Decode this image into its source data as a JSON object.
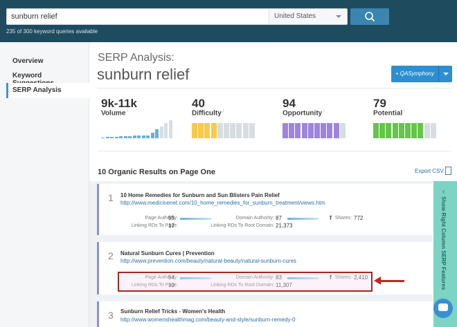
{
  "header": {
    "search_value": "sunburn relief",
    "country": "United States",
    "quota_text": "235 of 300 keyword queries available"
  },
  "sidebar": {
    "items": [
      {
        "label": "Overview"
      },
      {
        "label": "Keyword Suggestions"
      },
      {
        "label": "SERP Analysis",
        "active": true
      }
    ]
  },
  "main": {
    "section_label": "SERP Analysis:",
    "keyword": "sunburn relief",
    "qa_button": "+ QASymphony",
    "metrics": [
      {
        "value": "9k-11k",
        "label": "Volume",
        "color": "#6aaed6",
        "level": 1.0
      },
      {
        "value": "40",
        "label": "Difficulty",
        "color": "#f8c94a",
        "level": 0.4
      },
      {
        "value": "94",
        "label": "Opportunity",
        "color": "#9d85db",
        "level": 0.94
      },
      {
        "value": "79",
        "label": "Potential",
        "color": "#63c54a",
        "level": 0.79
      }
    ],
    "results_heading": "10 Organic Results on Page One",
    "export_label": "Export CSV",
    "side_panel_label": "Show Right Column SERP Features",
    "results": [
      {
        "rank": "1",
        "title": "10 Home Remedies for Sunburn and Sun Blisters Pain Relief",
        "url": "http://www.medicinenet.com/10_home_remedies_for_sunburn_treatment/views.htm",
        "page_authority_label": "Page Authority:",
        "page_authority": "55",
        "linking_rds_page_label": "Linking RDs To Page:",
        "linking_rds_page": "17",
        "domain_authority_label": "Domain Authority:",
        "domain_authority": "87",
        "linking_rds_domain_label": "Linking RDs To Root Domain:",
        "linking_rds_domain": "21,373",
        "shares_label": "Shares:",
        "shares": "772"
      },
      {
        "rank": "2",
        "title": "Natural Sunburn Cures | Prevention",
        "url": "http://www.prevention.com/beauty/natural-beauty/natural-sunburn-cures",
        "page_authority_label": "Page Authority:",
        "page_authority": "54",
        "linking_rds_page_label": "Linking RDs To Page:",
        "linking_rds_page": "10",
        "domain_authority_label": "Domain Authority:",
        "domain_authority": "83",
        "linking_rds_domain_label": "Linking RDs To Root Domain:",
        "linking_rds_domain": "11,307",
        "shares_label": "Shares:",
        "shares": "2,410"
      },
      {
        "rank": "3",
        "title": "Sunburn Relief Tricks - Women's Health",
        "url": "http://www.womenshealthmag.com/beauty-and-style/sunburn-remedy-0"
      }
    ]
  }
}
